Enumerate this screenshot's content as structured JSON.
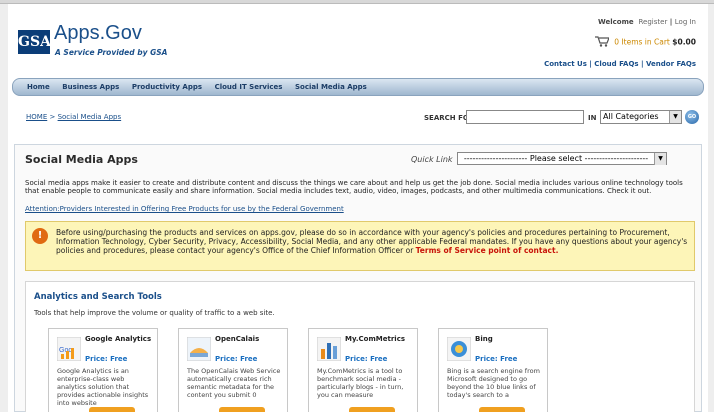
{
  "header": {
    "logo_text": "GSA",
    "site_name": "Apps.Gov",
    "tagline": "A Service Provided by GSA",
    "welcome": "Welcome",
    "register": "Register",
    "sep": "|",
    "login": "Log In",
    "cart_items": "0 Items in Cart",
    "cart_amount": "$0.00",
    "top_links": "Contact Us | Cloud FAQs | Vendor FAQs"
  },
  "nav": {
    "items": [
      "Home",
      "Business Apps",
      "Productivity Apps",
      "Cloud IT Services",
      "Social Media Apps"
    ]
  },
  "breadcrumb": {
    "home": "HOME",
    "sep": " > ",
    "current": "Social Media Apps"
  },
  "search": {
    "label": "SEARCH FOR",
    "value": "",
    "in_label": "IN",
    "category": "All Categories",
    "go_label": "GO"
  },
  "main": {
    "title": "Social Media Apps",
    "quick_link_label": "Quick Link",
    "quick_link_value": "---------------------- Please select ----------------------",
    "intro": "Social media apps make it easier to create and distribute content and discuss the things we care about and help us get the job done. Social media includes various online technology tools that enable people to communicate easily and share information. Social media includes text, audio, video, images, podcasts, and other multimedia communications. Check it out.",
    "attention": "Attention:Providers Interested in Offering Free Products for use by the Federal Government",
    "alert_text": "Before using/purchasing the products and services on apps.gov, please do so in accordance with your agency's policies and procedures pertaining to Procurement, Information Technology, Cyber Security, Privacy, Accessibility, Social Media, and any other applicable Federal mandates. If you have any questions about your agency's policies and procedures, please contact your agency's Office of the Chief Information Officer or ",
    "alert_link": "Terms of Service point of contact",
    "alert_end": "."
  },
  "section": {
    "title": "Analytics and Search Tools",
    "desc": "Tools that help improve the volume or quality of traffic to a web site."
  },
  "cards": [
    {
      "name": "Google Analytics",
      "price": "Price: Free",
      "desc": "Google Analytics is an enterprise-class web analytics solution that provides actionable insights into website"
    },
    {
      "name": "OpenCalais",
      "price": "Price: Free",
      "desc": "The OpenCalais Web Service automatically creates rich semantic metadata for the content you submit 0"
    },
    {
      "name": "My.ComMetrics",
      "price": "Price: Free",
      "desc": "My.ComMetrics is a tool to benchmark social media - particularly blogs - in turn, you can measure"
    },
    {
      "name": "Bing",
      "price": "Price: Free",
      "desc": "Bing is a search engine from Microsoft designed to go beyond the 10 blue links of today's search to a"
    }
  ],
  "colors": {
    "brand_blue": "#1a4f8a",
    "alert_bg": "#fdf5b8",
    "alert_link": "#c8140a",
    "button_orange": "#f0a020"
  },
  "icons": [
    "cart-icon",
    "alert-icon",
    "go-icon",
    "google-analytics-icon",
    "opencalais-icon",
    "commetrics-icon",
    "bing-icon"
  ]
}
